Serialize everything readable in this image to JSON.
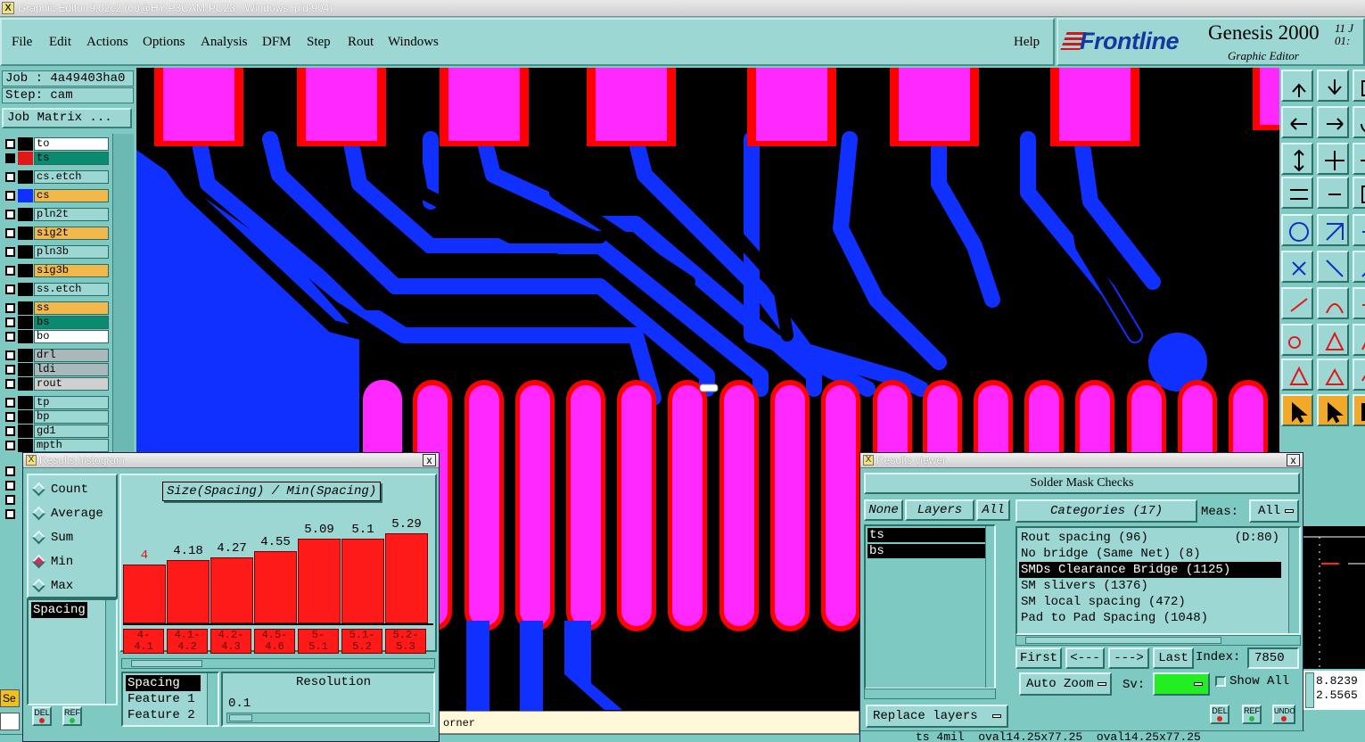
{
  "window": {
    "title": "Graphic Editor 9.02c2 (00@HY-P3CAM-PC23 - Windows, pid:904)"
  },
  "menu": {
    "items": [
      "File",
      "Edit",
      "Actions",
      "Options",
      "Analysis",
      "DFM",
      "Step",
      "Rout",
      "Windows"
    ],
    "help": "Help"
  },
  "brand": {
    "logo": "Frontline",
    "product": "Genesis 2000",
    "subtitle": "Graphic Editor",
    "date_line1": "11 J",
    "date_line2": "01:"
  },
  "job": {
    "job_label": "Job : 4a49403ha0",
    "step_label": "Step: cam",
    "matrix_button": "Job Matrix ..."
  },
  "layers": [
    {
      "name": "to",
      "color": "#ffffff",
      "swatch": "#000000"
    },
    {
      "name": "ts",
      "color": "#0a8a6e",
      "swatch": "#e01818",
      "active": true
    },
    {
      "name": "cs.etch",
      "color": "#9dd7d3",
      "swatch": "#000000"
    },
    {
      "name": "cs",
      "color": "#f2b84c",
      "swatch": "#1030ff"
    },
    {
      "name": "pln2t",
      "color": "#9dd7d3",
      "swatch": "#000000"
    },
    {
      "name": "sig2t",
      "color": "#f2b84c",
      "swatch": "#000000"
    },
    {
      "name": "pln3b",
      "color": "#9dd7d3",
      "swatch": "#000000"
    },
    {
      "name": "sig3b",
      "color": "#f2b84c",
      "swatch": "#000000"
    },
    {
      "name": "ss.etch",
      "color": "#9dd7d3",
      "swatch": "#000000"
    },
    {
      "name": "ss",
      "color": "#f2b84c",
      "swatch": "#000000"
    },
    {
      "name": "bs",
      "color": "#0a8a6e",
      "swatch": "#000000"
    },
    {
      "name": "bo",
      "color": "#ffffff",
      "swatch": "#000000"
    },
    {
      "name": "drl",
      "color": "#a9b8bb",
      "swatch": "#000000"
    },
    {
      "name": "ldi",
      "color": "#a9b8bb",
      "swatch": "#000000"
    },
    {
      "name": "rout",
      "color": "#d0d0d0",
      "swatch": "#000000"
    },
    {
      "name": "tp",
      "color": "#9dd7d3",
      "swatch": "#000000"
    },
    {
      "name": "bp",
      "color": "#9dd7d3",
      "swatch": "#000000"
    },
    {
      "name": "gd1",
      "color": "#9dd7d3",
      "swatch": "#000000"
    },
    {
      "name": "mpth",
      "color": "#9dd7d3",
      "swatch": "#000000"
    }
  ],
  "histogram": {
    "title": "Results histogram",
    "close": "x",
    "modes": [
      "Count",
      "Average",
      "Sum",
      "Min",
      "Max"
    ],
    "selected_mode": "Min",
    "chart_title": "Size(Spacing) / Min(Spacing)",
    "property": "Spacing",
    "properties": [
      "Spacing",
      "Feature 1",
      "Feature 2"
    ],
    "resolution_label": "Resolution",
    "resolution_value": "0.1",
    "del_label": "DEL",
    "ref_label": "REF"
  },
  "chart_data": {
    "type": "bar",
    "title": "Size(Spacing) / Min(Spacing)",
    "categories": [
      "4-4.1",
      "4.1-4.2",
      "4.2-4.3",
      "4.5-4.6",
      "5-5.1",
      "5.1-5.2",
      "5.2-5.3"
    ],
    "bin_labels": [
      [
        "4-",
        "4.1"
      ],
      [
        "4.1-",
        "4.2"
      ],
      [
        "4.2-",
        "4.3"
      ],
      [
        "4.5-",
        "4.6"
      ],
      [
        "5-",
        "5.1"
      ],
      [
        "5.1-",
        "5.2"
      ],
      [
        "5.2-",
        "5.3"
      ]
    ],
    "values": [
      4,
      4.18,
      4.27,
      4.55,
      5.09,
      5.1,
      5.29
    ],
    "value_labels": [
      "4",
      "4.18",
      "4.27",
      "4.55",
      "5.09",
      "5.1",
      "5.29"
    ],
    "selected_index": 0,
    "ylim": [
      3.0,
      5.29
    ],
    "bar_color": "#ff1a1a"
  },
  "results": {
    "title": "Results viewer",
    "close": "x",
    "header": "Solder Mask Checks",
    "none_btn": "None",
    "layers_btn": "Layers",
    "all_btn": "All",
    "layers": [
      "ts",
      "bs"
    ],
    "categories_btn": "Categories (17)",
    "meas_label": "Meas:",
    "meas_value": "All",
    "categories": [
      {
        "text": "Rout spacing (96)",
        "extra": "(D:80)"
      },
      {
        "text": "No bridge (Same Net) (8)",
        "extra": ""
      },
      {
        "text": "SMDs Clearance Bridge (1125)",
        "extra": "",
        "selected": true
      },
      {
        "text": "SM slivers (1376)",
        "extra": ""
      },
      {
        "text": "SM local spacing (472)",
        "extra": ""
      },
      {
        "text": "Pad to Pad Spacing (1048)",
        "extra": ""
      }
    ],
    "first_btn": "First",
    "prev_btn": "<---",
    "next_btn": "--->",
    "last_btn": "Last",
    "index_label": "Index:",
    "index_value": "7850",
    "autozoom": "Auto Zoom",
    "sv_label": "Sv:",
    "show_all": "Show All",
    "replace_layers": "Replace layers",
    "del_label": "DEL",
    "ref_label": "REF",
    "undo_label": "UNDO",
    "status": "ts 4mil  oval14.25x77.25  oval14.25x77.25"
  },
  "status_bar": {
    "text": "orner",
    "sel_label": "Se"
  },
  "coords": {
    "x": "8.8239",
    "y": "2.5565"
  },
  "colors": {
    "panel": "#7fc9c3",
    "pad": "#ff28ff",
    "copper": "#1030ff",
    "mask": "#ff0000"
  }
}
